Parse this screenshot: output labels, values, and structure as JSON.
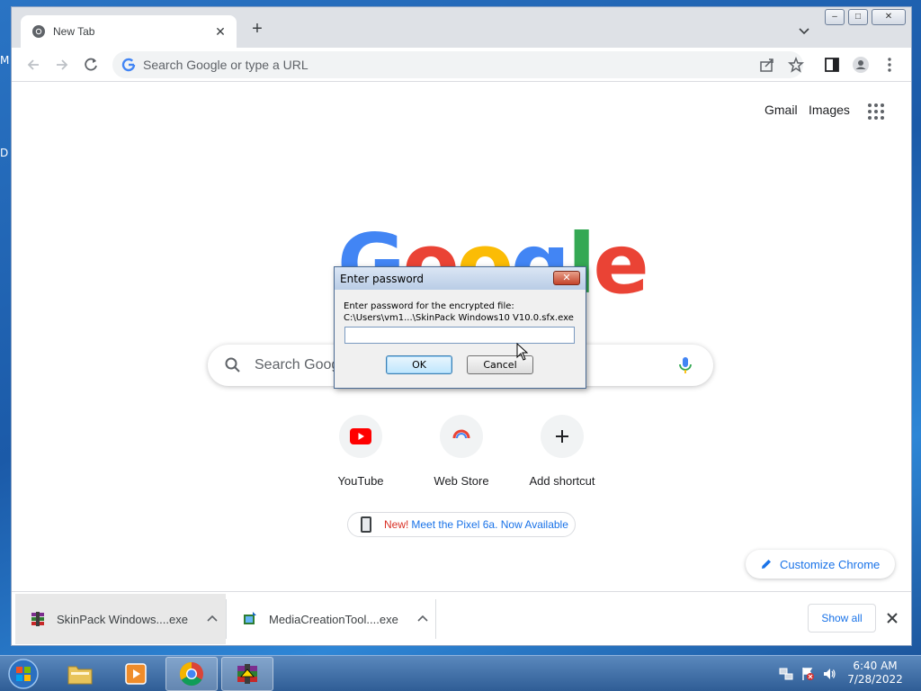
{
  "desktop": {
    "edge_label_1": "M",
    "edge_label_2": "D"
  },
  "browser": {
    "tab_title": "New Tab",
    "window_controls": {
      "minimize": "–",
      "maximize": "□",
      "close": "✕"
    },
    "omnibox_placeholder": "Search Google or type a URL",
    "top_links": {
      "gmail": "Gmail",
      "images": "Images"
    },
    "logo_letters": [
      "G",
      "o",
      "o",
      "g",
      "l",
      "e"
    ],
    "logo_colors": [
      "#4285f4",
      "#ea4335",
      "#fbbc05",
      "#4285f4",
      "#34a853",
      "#ea4335"
    ],
    "search_placeholder": "Search Google or type a URL",
    "shortcuts": [
      {
        "label": "YouTube"
      },
      {
        "label": "Web Store"
      },
      {
        "label": "Add shortcut"
      }
    ],
    "promo": {
      "new": "New!",
      "text": "Meet the Pixel 6a. Now Available"
    },
    "customize_label": "Customize Chrome"
  },
  "downloads": {
    "items": [
      {
        "name": "SkinPack Windows....exe"
      },
      {
        "name": "MediaCreationTool....exe"
      }
    ],
    "show_all": "Show all"
  },
  "dialog": {
    "title": "Enter password",
    "line1": "Enter password for the encrypted file:",
    "line2": "C:\\Users\\vm1...\\SkinPack Windows10 V10.0.sfx.exe",
    "password_value": "",
    "ok": "OK",
    "cancel": "Cancel",
    "close": "✕"
  },
  "taskbar": {
    "time": "6:40 AM",
    "date": "7/28/2022"
  },
  "colors": {
    "accent": "#1a73e8",
    "taskbar": "#3b6aa3",
    "dialog_bg": "#f0f0f0"
  }
}
